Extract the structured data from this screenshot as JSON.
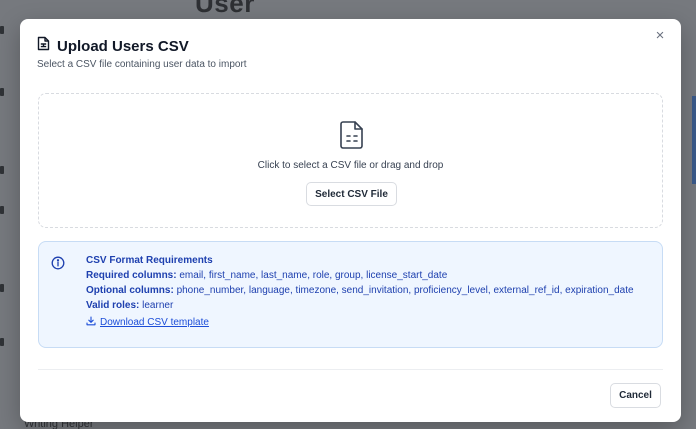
{
  "background": {
    "heading": "User",
    "footer_text": "Writing Helper"
  },
  "modal": {
    "title": "Upload Users CSV",
    "subtitle": "Select a CSV file containing user data to import",
    "close_label": "×",
    "dropzone": {
      "prompt": "Click to select a CSV file or drag and drop",
      "button_label": "Select CSV File"
    },
    "requirements": {
      "title": "CSV Format Requirements",
      "required_label": "Required columns:",
      "required_value": "email, first_name, last_name, role, group, license_start_date",
      "optional_label": "Optional columns:",
      "optional_value": "phone_number, language, timezone, send_invitation, proficiency_level, external_ref_id, expiration_date",
      "roles_label": "Valid roles:",
      "roles_value": "learner",
      "download_label": "Download CSV template"
    },
    "cancel_label": "Cancel"
  },
  "icons": {
    "title": "file-spreadsheet-icon",
    "dropzone": "file-spreadsheet-icon",
    "info": "info-circle-icon",
    "download": "download-icon",
    "close": "close-icon"
  },
  "colors": {
    "info_text": "#1e40af",
    "info_bg": "#eff6ff",
    "overlay": "#76797e"
  }
}
